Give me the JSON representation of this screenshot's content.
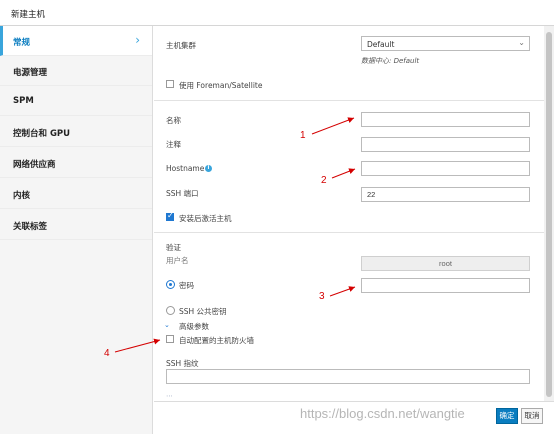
{
  "dialog": {
    "title": "新建主机"
  },
  "sidebar": {
    "items": [
      {
        "label": "常规",
        "active": true
      },
      {
        "label": "电源管理"
      },
      {
        "label": "SPM"
      },
      {
        "label": "控制台和 GPU"
      },
      {
        "label": "网络供应商"
      },
      {
        "label": "内核"
      },
      {
        "label": "关联标签"
      }
    ]
  },
  "form": {
    "cluster_label": "主机集群",
    "cluster_value": "Default",
    "datacenter_hint": "数据中心: Default",
    "foreman_label": "使用 Foreman/Satellite",
    "name_label": "名称",
    "name_value": "",
    "comment_label": "注释",
    "comment_value": "",
    "hostname_label": "Hostname",
    "hostname_value": "",
    "ssh_port_label": "SSH 端口",
    "ssh_port_value": "22",
    "activate_label": "安装后激活主机",
    "activate_checked": true,
    "auth_section_label": "验证",
    "username_label": "用户名",
    "username_value": "root",
    "password_label": "密码",
    "password_value": "",
    "ssh_key_label": "SSH 公共密钥",
    "advanced_label": "高级参数",
    "firewall_label": "自动配置的主机防火墙",
    "fingerprint_label": "SSH 指纹",
    "fingerprint_value": ""
  },
  "footer": {
    "ok_label": "确定",
    "cancel_label": "取消"
  },
  "annotations": {
    "color": "#d40000",
    "labels": [
      "1",
      "2",
      "3",
      "4"
    ]
  },
  "watermark": "https://blog.csdn.net/wangtie"
}
